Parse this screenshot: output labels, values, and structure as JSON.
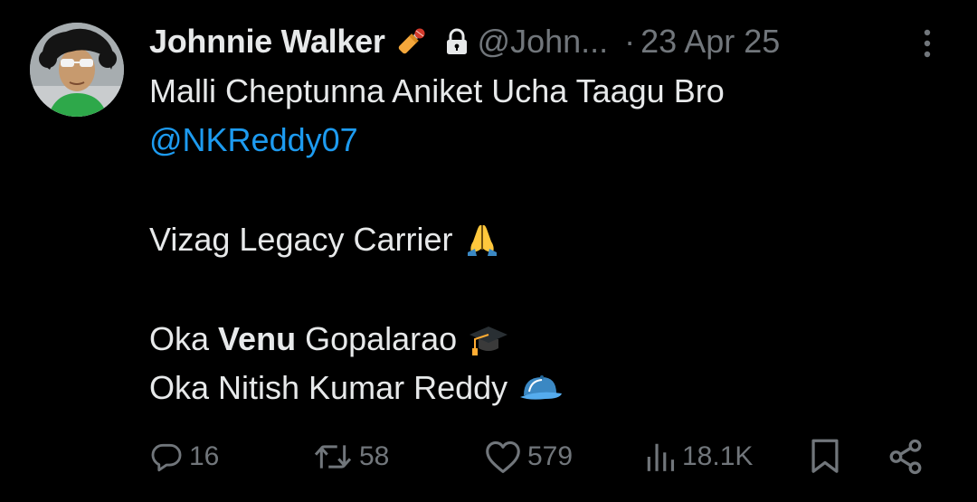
{
  "post": {
    "display_name": "Johnnie Walker",
    "name_emoji": "cricket-bat-icon",
    "protected_icon": "lock-icon",
    "handle": "@John...",
    "separator": "·",
    "date": "23 Apr 25",
    "more_icon": "more-vertical-icon",
    "text": {
      "line1": "Malli Cheptunna Aniket Ucha Taagu Bro",
      "mention": "@NKReddy07",
      "line3": "Vizag Legacy Carrier",
      "line3_emoji": "folded-hands-icon",
      "line4_prefix": "Oka ",
      "line4_bold": "Venu",
      "line4_suffix": " Gopalarao",
      "line4_emoji": "graduation-cap-icon",
      "line5": "Oka Nitish Kumar Reddy",
      "line5_emoji": "billed-cap-icon"
    }
  },
  "actions": {
    "replies": "16",
    "reposts": "58",
    "likes": "579",
    "views": "18.1K",
    "bookmark_icon": "bookmark-icon",
    "share_icon": "share-icon"
  },
  "colors": {
    "background": "#000000",
    "text": "#e7e9ea",
    "secondary": "#71767b",
    "link": "#1d9bf0"
  }
}
